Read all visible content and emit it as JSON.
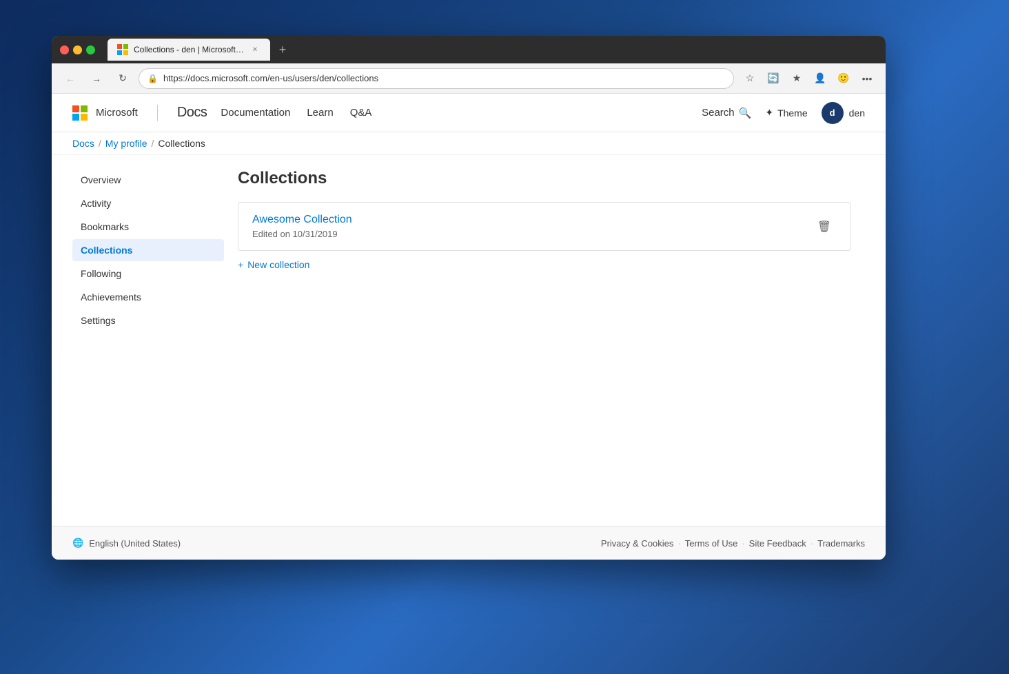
{
  "browser": {
    "tab_title": "Collections - den | Microsoft Do",
    "url": "https://docs.microsoft.com/en-us/users/den/collections",
    "url_domain": "docs.microsoft.com",
    "url_path": "/en-us/users/den/collections"
  },
  "site": {
    "brand_ms": "Microsoft",
    "brand_docs": "Docs",
    "nav_items": [
      "Documentation",
      "Learn",
      "Q&A"
    ],
    "search_label": "Search",
    "theme_label": "Theme",
    "user_name": "den",
    "user_initials": "d"
  },
  "breadcrumb": {
    "docs": "Docs",
    "my_profile": "My profile",
    "collections": "Collections"
  },
  "sidebar": {
    "items": [
      {
        "id": "overview",
        "label": "Overview"
      },
      {
        "id": "activity",
        "label": "Activity"
      },
      {
        "id": "bookmarks",
        "label": "Bookmarks"
      },
      {
        "id": "collections",
        "label": "Collections"
      },
      {
        "id": "following",
        "label": "Following"
      },
      {
        "id": "achievements",
        "label": "Achievements"
      },
      {
        "id": "settings",
        "label": "Settings"
      }
    ]
  },
  "main": {
    "page_title": "Collections",
    "collections": [
      {
        "name": "Awesome Collection",
        "edited": "Edited on 10/31/2019"
      }
    ],
    "new_collection_label": "New collection"
  },
  "footer": {
    "locale": "English (United States)",
    "links": [
      {
        "label": "Privacy & Cookies"
      },
      {
        "label": "Terms of Use"
      },
      {
        "label": "Site Feedback"
      },
      {
        "label": "Trademarks"
      }
    ]
  }
}
